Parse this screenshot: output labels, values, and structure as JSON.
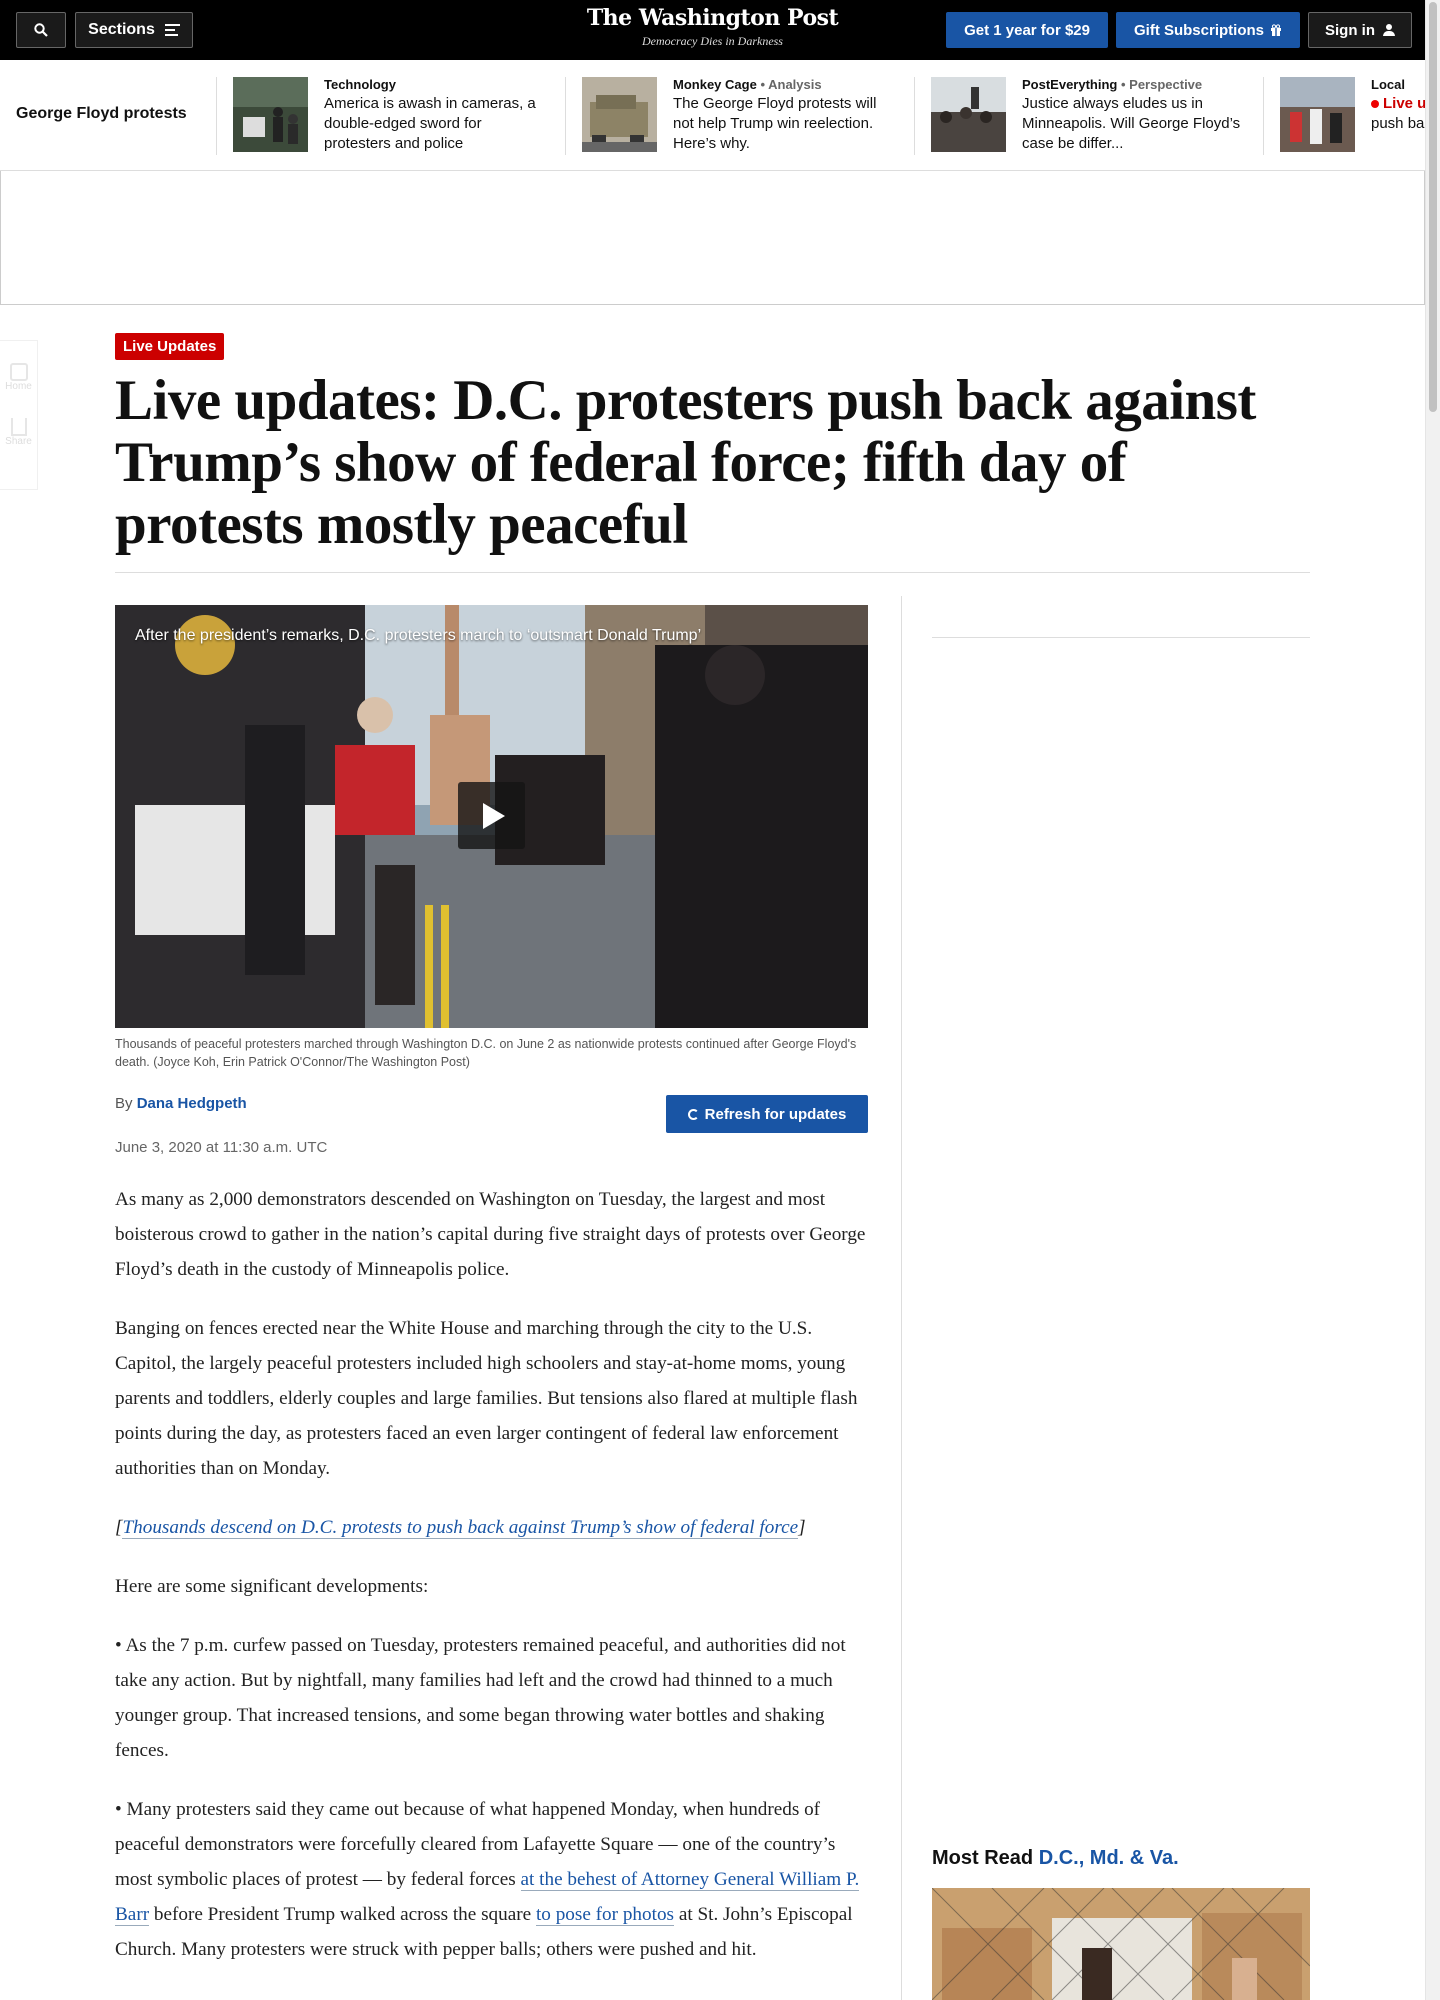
{
  "header": {
    "search_icon": "search-icon",
    "sections_label": "Sections",
    "masthead_title": "The Washington Post",
    "masthead_tagline": "Democracy Dies in Darkness",
    "subscribe_label": "Get 1 year for $29",
    "gift_label": "Gift Subscriptions",
    "signin_label": "Sign in"
  },
  "topic_bar": {
    "label": "George Floyd protests",
    "stories": [
      {
        "section": "Technology",
        "type": "",
        "headline": "America is awash in cameras, a double-edged sword for protesters and police"
      },
      {
        "section": "Monkey Cage",
        "type": "• Analysis",
        "headline": "The George Floyd protests will not help Trump win reelection. Here’s why."
      },
      {
        "section": "PostEverything",
        "type": "• Perspective",
        "headline": "Justice always eludes us in Minneapolis. Will George Floyd’s case be differ..."
      },
      {
        "section": "Local",
        "type": "",
        "live": "Live u",
        "headline": "push ba of federa"
      }
    ]
  },
  "share_rail": {
    "home_label": "Home",
    "share_label": "Share"
  },
  "article": {
    "badge": "Live Updates",
    "headline": "Live updates: D.C. protesters push back against Trump’s show of federal force; fifth day of protests mostly peaceful",
    "video_title": "After the president’s remarks, D.C. protesters march to ‘outsmart Donald Trump’",
    "caption": "Thousands of peaceful protesters marched through Washington D.C. on June 2 as nationwide protests continued after George Floyd's death. (Joyce Koh, Erin Patrick O'Connor/The Washington Post)",
    "by_prefix": "By",
    "author": "Dana Hedgpeth",
    "refresh_label": "Refresh for updates",
    "timestamp": "June 3, 2020 at 11:30 a.m. UTC",
    "p1": "As many as 2,000 demonstrators descended on Washington on Tuesday, the largest and most boisterous crowd to gather in the nation’s capital during five straight days of protests over George Floyd’s death in the custody of Minneapolis police.",
    "p2": "Banging on fences erected near the White House and marching through the city to the U.S. Capitol, the largely peaceful protesters included high schoolers and stay-at-home moms, young parents and toddlers, elderly couples and large families. But tensions also flared at multiple flash points during the day, as protesters faced an even larger contingent of federal law enforcement authorities than on Monday.",
    "p3_open": "[",
    "p3_link": "Thousands descend on D.C. protests to push back against Trump’s show of federal force",
    "p3_close": "]",
    "p4": "Here are some significant developments:",
    "p5": "• As the 7 p.m. curfew passed on Tuesday, protesters remained peaceful, and authorities did not take any action. But by nightfall, many families had left and the crowd had thinned to a much younger group. That increased tensions, and some began throwing water bottles and shaking fences.",
    "p6_a": "• Many protesters said they came out because of what happened Monday, when hundreds of peaceful demonstrators were forcefully cleared from Lafayette Square — one of the country’s most symbolic places of protest — by federal forces ",
    "p6_link1": "at the behest of Attorney General William P. Barr",
    "p6_b": " before President Trump walked across the square ",
    "p6_link2": "to pose for photos",
    "p6_c": " at St. John’s Episcopal Church. Many protesters were struck with pepper balls; others were pushed and hit."
  },
  "sidebar": {
    "most_read": "Most Read",
    "most_read_region": "D.C., Md. & Va."
  },
  "colors": {
    "brand_blue": "#1955a5",
    "live_red": "#cc0000"
  }
}
